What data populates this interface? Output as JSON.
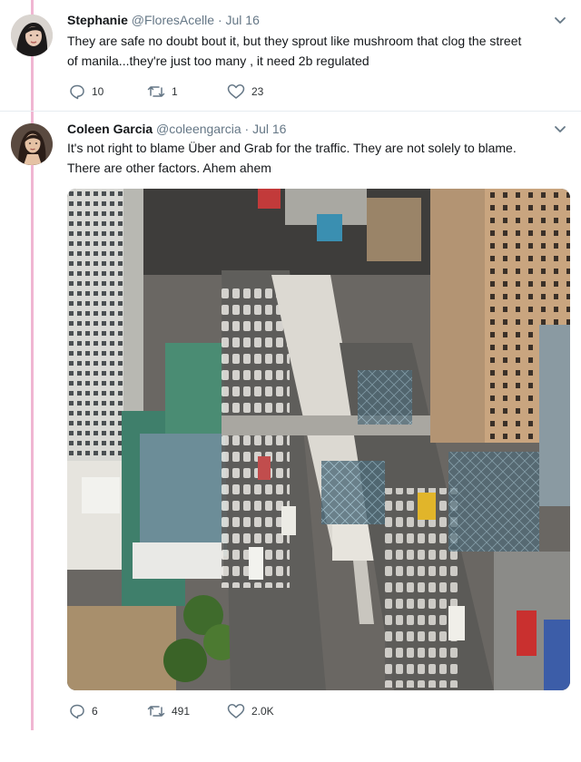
{
  "tweets": [
    {
      "name": "Stephanie",
      "handle": "@FloresAcelle",
      "separator": "·",
      "date": "Jul 16",
      "text_lines": [
        "They are safe no doubt bout it, but they sprout like mushroom that clog the street",
        "of manila...they're just too many , it need 2b regulated"
      ],
      "replies": "10",
      "retweets": "1",
      "likes": "23"
    },
    {
      "name": "Coleen Garcia",
      "handle": "@coleengarcia",
      "separator": "·",
      "date": "Jul 16",
      "text_lines": [
        "It's not right to blame Über and Grab for the traffic. They are not solely to blame.",
        "There are other factors. Ahem ahem"
      ],
      "replies": "6",
      "retweets": "491",
      "likes": "2.0K"
    }
  ],
  "colors": {
    "thread_line": "#f0b6d2",
    "secondary_text": "#657786",
    "primary_text": "#14171a"
  },
  "icons": {
    "reply": "reply-icon",
    "retweet": "retweet-icon",
    "like": "heart-icon",
    "menu": "chevron-down-icon"
  }
}
